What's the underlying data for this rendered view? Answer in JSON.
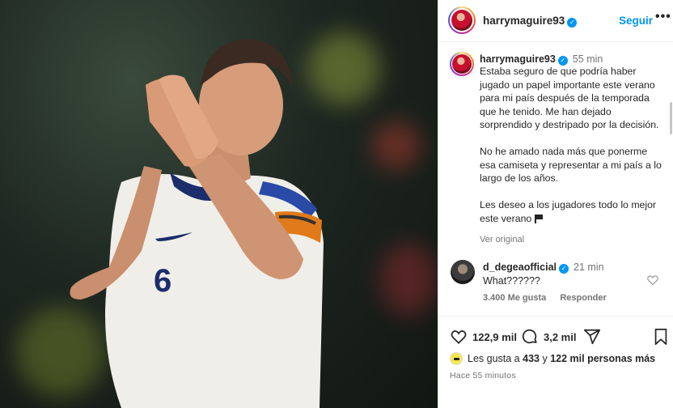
{
  "post": {
    "photo_alt": "Player applauding in white kit number 6"
  },
  "header": {
    "username": "harrymaguire93",
    "follow_label": "Seguir",
    "more_label": "•••"
  },
  "caption": {
    "username": "harrymaguire93",
    "time": "55 min",
    "paragraphs": [
      "Estaba seguro de que podría haber jugado un papel importante este verano para mi país después de la temporada que he tenido. Me han dejado sorprendido y destripado por la decisión.",
      "No he amado nada más que ponerme esa camiseta y representar a mi país a lo largo de los años.",
      "Les deseo a los jugadores todo lo mejor este verano"
    ],
    "see_original": "Ver original"
  },
  "comment": {
    "username": "d_degeaofficial",
    "time": "21 min",
    "text": "What??????",
    "likes": "3.400 Me gusta",
    "reply": "Responder"
  },
  "actions": {
    "likes_count": "122,9 mil",
    "comments_count": "3,2 mil"
  },
  "liked_by": {
    "prefix": "Les gusta a",
    "count": "433",
    "middle": "y",
    "others": "122 mil personas más"
  },
  "posted_ago": "Hace 55 minutos",
  "colors": {
    "accent": "#0095f6",
    "verified": "#0095f6",
    "muted": "#737373"
  }
}
